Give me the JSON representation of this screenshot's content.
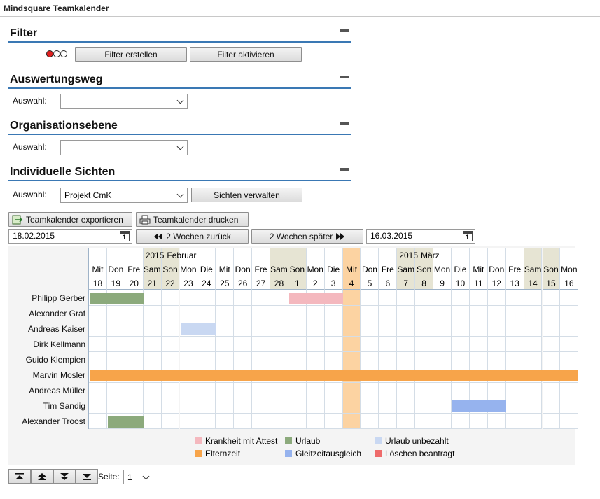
{
  "app": {
    "title": "Mindsquare Teamkalender"
  },
  "filter": {
    "title": "Filter",
    "create_label": "Filter erstellen",
    "activate_label": "Filter aktivieren"
  },
  "auswertungsweg": {
    "title": "Auswertungsweg",
    "label": "Auswahl:",
    "value": ""
  },
  "organisationsebene": {
    "title": "Organisationsebene",
    "label": "Auswahl:",
    "value": ""
  },
  "sichten": {
    "title": "Individuelle Sichten",
    "label": "Auswahl:",
    "value": "Projekt CmK",
    "manage_label": "Sichten verwalten"
  },
  "toolbar": {
    "export_label": "Teamkalender exportieren",
    "print_label": "Teamkalender drucken",
    "date_from": "18.02.2015",
    "back_label": "2 Wochen zurück",
    "forward_label": "2 Wochen später",
    "date_to": "16.03.2015"
  },
  "calendar": {
    "months": [
      {
        "year": "2015",
        "name": "Februar",
        "start_index": 3
      },
      {
        "year": "2015",
        "name": "März",
        "start_index": 17
      }
    ],
    "days": [
      {
        "wd": "Mit",
        "d": "18",
        "type": ""
      },
      {
        "wd": "Don",
        "d": "19",
        "type": ""
      },
      {
        "wd": "Fre",
        "d": "20",
        "type": ""
      },
      {
        "wd": "Sam",
        "d": "21",
        "type": "we"
      },
      {
        "wd": "Son",
        "d": "22",
        "type": "we"
      },
      {
        "wd": "Mon",
        "d": "23",
        "type": ""
      },
      {
        "wd": "Die",
        "d": "24",
        "type": ""
      },
      {
        "wd": "Mit",
        "d": "25",
        "type": ""
      },
      {
        "wd": "Don",
        "d": "26",
        "type": ""
      },
      {
        "wd": "Fre",
        "d": "27",
        "type": ""
      },
      {
        "wd": "Sam",
        "d": "28",
        "type": "we"
      },
      {
        "wd": "Son",
        "d": "1",
        "type": "we"
      },
      {
        "wd": "Mon",
        "d": "2",
        "type": ""
      },
      {
        "wd": "Die",
        "d": "3",
        "type": ""
      },
      {
        "wd": "Mit",
        "d": "4",
        "type": "today"
      },
      {
        "wd": "Don",
        "d": "5",
        "type": ""
      },
      {
        "wd": "Fre",
        "d": "6",
        "type": ""
      },
      {
        "wd": "Sam",
        "d": "7",
        "type": "we"
      },
      {
        "wd": "Son",
        "d": "8",
        "type": "we"
      },
      {
        "wd": "Mon",
        "d": "9",
        "type": ""
      },
      {
        "wd": "Die",
        "d": "10",
        "type": ""
      },
      {
        "wd": "Mit",
        "d": "11",
        "type": ""
      },
      {
        "wd": "Don",
        "d": "12",
        "type": ""
      },
      {
        "wd": "Fre",
        "d": "13",
        "type": ""
      },
      {
        "wd": "Sam",
        "d": "14",
        "type": "we"
      },
      {
        "wd": "Son",
        "d": "15",
        "type": "we"
      },
      {
        "wd": "Mon",
        "d": "16",
        "type": ""
      }
    ],
    "people": [
      {
        "name": "Philipp Gerber",
        "bars": [
          {
            "start": 0,
            "end": 2,
            "color": "#8caa7c"
          },
          {
            "start": 11,
            "end": 13,
            "color": "#f4b8be"
          }
        ]
      },
      {
        "name": "Alexander Graf",
        "bars": []
      },
      {
        "name": "Andreas Kaiser",
        "bars": [
          {
            "start": 5,
            "end": 6,
            "color": "#c9d8f2"
          }
        ]
      },
      {
        "name": "Dirk Kellmann",
        "bars": []
      },
      {
        "name": "Guido Klempien",
        "bars": []
      },
      {
        "name": "Marvin Mosler",
        "bars": [
          {
            "start": 0,
            "end": 26,
            "color": "#f7a44a"
          }
        ]
      },
      {
        "name": "Andreas Müller",
        "bars": []
      },
      {
        "name": "Tim Sandig",
        "bars": [
          {
            "start": 20,
            "end": 22,
            "color": "#96b3ee"
          }
        ]
      },
      {
        "name": "Alexander Troost",
        "bars": [
          {
            "start": 1,
            "end": 2,
            "color": "#8caa7c"
          }
        ]
      }
    ]
  },
  "legend": [
    {
      "label": "Krankheit mit Attest",
      "color": "#f4b8be"
    },
    {
      "label": "Urlaub",
      "color": "#8caa7c"
    },
    {
      "label": "Urlaub unbezahlt",
      "color": "#c9d8f2"
    },
    {
      "label": "Elternzeit",
      "color": "#f7a44a"
    },
    {
      "label": "Gleitzeitausgleich",
      "color": "#96b3ee"
    },
    {
      "label": "Löschen beantragt",
      "color": "#ee6b6b"
    }
  ],
  "paging": {
    "label": "Seite:",
    "value": "1"
  }
}
